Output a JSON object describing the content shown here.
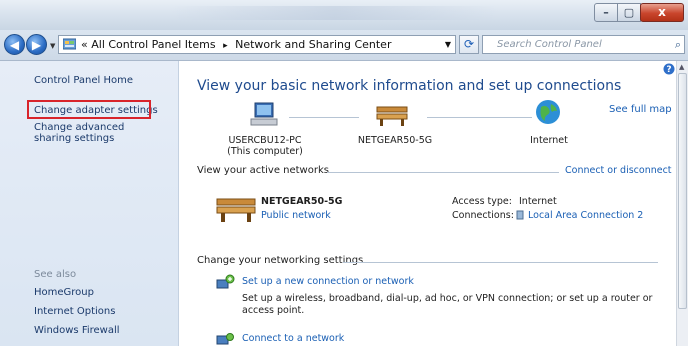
{
  "window": {
    "minimize_glyph": "–",
    "maximize_glyph": "▢",
    "close_glyph": "x"
  },
  "address_bar": {
    "prefix": "«",
    "crumbs": [
      "All Control Panel Items",
      "Network and Sharing Center"
    ],
    "crumb_separator": "▸",
    "search_placeholder": "Search Control Panel"
  },
  "sidebar": {
    "home": "Control Panel Home",
    "links": [
      "Change adapter settings",
      "Change advanced sharing settings"
    ],
    "see_also_title": "See also",
    "see_also": [
      "HomeGroup",
      "Internet Options",
      "Windows Firewall"
    ]
  },
  "main": {
    "heading": "View your basic network information and set up connections",
    "see_full_map": "See full map",
    "nodes": [
      {
        "label": "USERCBU12-PC",
        "sublabel": "(This computer)",
        "icon": "computer-icon"
      },
      {
        "label": "NETGEAR50-5G",
        "icon": "bench-network-icon"
      },
      {
        "label": "Internet",
        "icon": "globe-icon"
      }
    ],
    "active_networks_title": "View your active networks",
    "connect_or_disconnect": "Connect or disconnect",
    "active_network": {
      "name": "NETGEAR50-5G",
      "type": "Public network",
      "access_type_label": "Access type:",
      "access_type_value": "Internet",
      "connections_label": "Connections:",
      "connections_value": "Local Area Connection 2"
    },
    "change_settings_title": "Change your networking settings",
    "tasks": [
      {
        "title": "Set up a new connection or network",
        "desc": "Set up a wireless, broadband, dial-up, ad hoc, or VPN connection; or set up a router or access point.",
        "icon": "new-connection-icon"
      },
      {
        "title": "Connect to a network",
        "desc": "",
        "icon": "connect-network-icon"
      }
    ]
  },
  "colors": {
    "link": "#1a5fb4",
    "heading": "#1f4b8e",
    "highlight_box": "#d8242b"
  }
}
